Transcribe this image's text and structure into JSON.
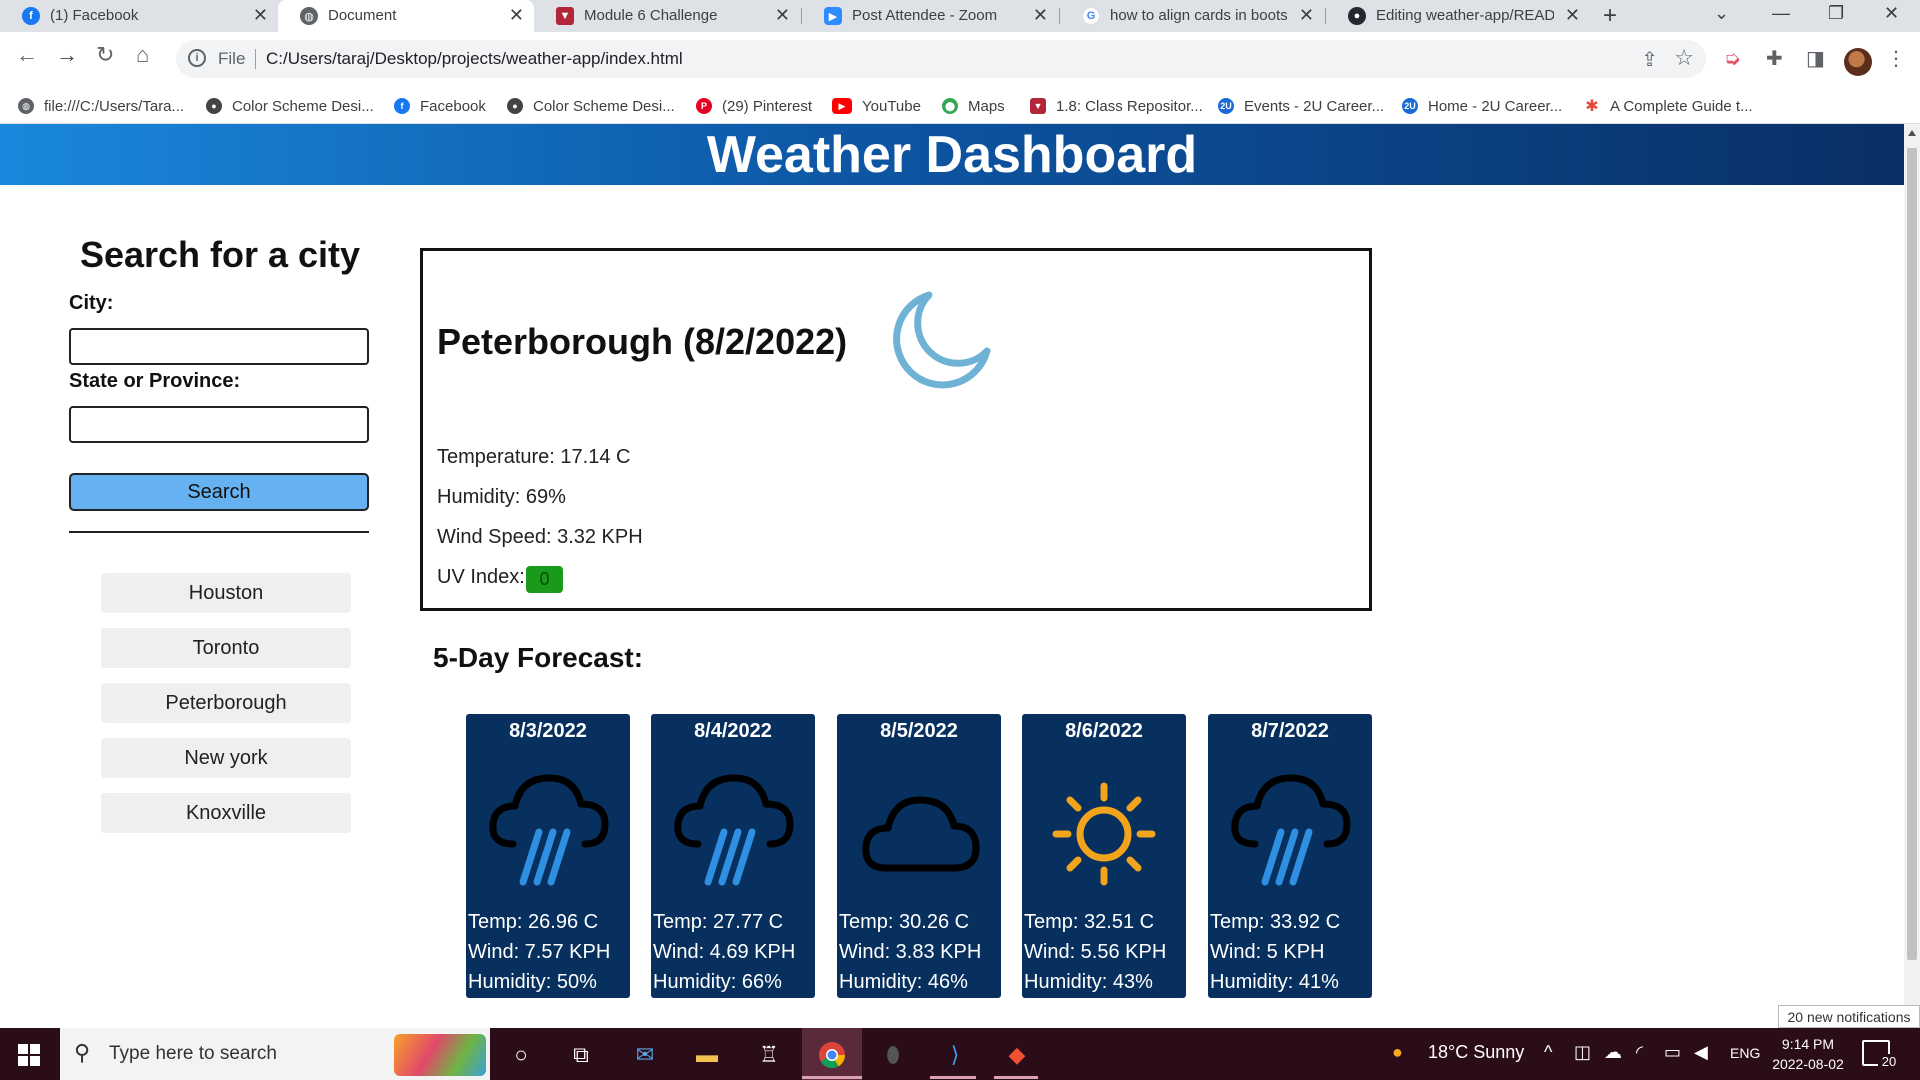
{
  "browser": {
    "tabs": [
      {
        "title": "(1) Facebook",
        "icon": "facebook-icon",
        "color": "#1877f2"
      },
      {
        "title": "Document",
        "icon": "globe-icon",
        "color": "#5f6368",
        "active": true
      },
      {
        "title": "Module 6 Challenge",
        "icon": "bootcamp-icon",
        "color": "#b3263a"
      },
      {
        "title": "Post Attendee - Zoom",
        "icon": "zoom-icon",
        "color": "#2d8cff"
      },
      {
        "title": "how to align cards in boots",
        "icon": "google-icon",
        "color": "#4285f4"
      },
      {
        "title": "Editing weather-app/READ",
        "icon": "github-icon",
        "color": "#24292f"
      }
    ],
    "address": {
      "scheme": "File",
      "url": "C:/Users/taraj/Desktop/projects/weather-app/index.html"
    },
    "bookmarks": [
      {
        "label": "file:///C:/Users/Tara...",
        "icon": "globe-icon",
        "color": "#5f6368"
      },
      {
        "label": "Color Scheme Desi...",
        "icon": "colorscheme-icon",
        "color": "#444444"
      },
      {
        "label": "Facebook",
        "icon": "facebook-icon",
        "color": "#1877f2"
      },
      {
        "label": "Color Scheme Desi...",
        "icon": "colorscheme-icon",
        "color": "#444444"
      },
      {
        "label": "(29) Pinterest",
        "icon": "pinterest-icon",
        "color": "#e60023"
      },
      {
        "label": "YouTube",
        "icon": "youtube-icon",
        "color": "#ff0000"
      },
      {
        "label": "Maps",
        "icon": "maps-icon",
        "color": "#34a853"
      },
      {
        "label": "1.8: Class Repositor...",
        "icon": "bootcamp-icon",
        "color": "#b3263a"
      },
      {
        "label": "Events - 2U Career...",
        "icon": "2u-icon",
        "color": "#1a6ad8"
      },
      {
        "label": "Home - 2U Career...",
        "icon": "2u-icon",
        "color": "#1a6ad8"
      },
      {
        "label": "A Complete Guide t...",
        "icon": "asterisk-icon",
        "color": "#e24a3a"
      }
    ]
  },
  "page": {
    "header_title": "Weather Dashboard",
    "search": {
      "title": "Search for a city",
      "city_label": "City:",
      "city_value": "",
      "state_label": "State or Province:",
      "state_value": "",
      "button_label": "Search",
      "button_color": "#65b1f1"
    },
    "history": [
      "Houston",
      "Toronto",
      "Peterborough",
      "New york",
      "Knoxville"
    ],
    "current": {
      "title": "Peterborough (8/2/2022)",
      "icon": "moon-icon",
      "temperature": "Temperature: 17.14 C",
      "humidity": "Humidity: 69%",
      "wind": "Wind Speed: 3.32 KPH",
      "uv_label": "UV Index:",
      "uv_value": "0",
      "uv_color": "#1a9a1a"
    },
    "forecast_title": "5-Day Forecast:",
    "forecast": [
      {
        "date": "8/3/2022",
        "icon": "rain-icon",
        "temp": "Temp: 26.96 C",
        "wind": "Wind: 7.57 KPH",
        "humidity": "Humidity: 50%"
      },
      {
        "date": "8/4/2022",
        "icon": "rain-icon",
        "temp": "Temp: 27.77 C",
        "wind": "Wind: 4.69 KPH",
        "humidity": "Humidity: 66%"
      },
      {
        "date": "8/5/2022",
        "icon": "cloud-icon",
        "temp": "Temp: 30.26 C",
        "wind": "Wind: 3.83 KPH",
        "humidity": "Humidity: 46%"
      },
      {
        "date": "8/6/2022",
        "icon": "sun-icon",
        "temp": "Temp: 32.51 C",
        "wind": "Wind: 5.56 KPH",
        "humidity": "Humidity: 43%"
      },
      {
        "date": "8/7/2022",
        "icon": "rain-icon",
        "temp": "Temp: 33.92 C",
        "wind": "Wind: 5 KPH",
        "humidity": "Humidity: 41%"
      }
    ],
    "card_color": "#07305f",
    "notification_toast": "20 new notifications"
  },
  "taskbar": {
    "search_placeholder": "Type here to search",
    "weather": "18°C  Sunny",
    "language": "ENG",
    "time": "9:14 PM",
    "date": "2022-08-02",
    "notification_count": "20"
  }
}
